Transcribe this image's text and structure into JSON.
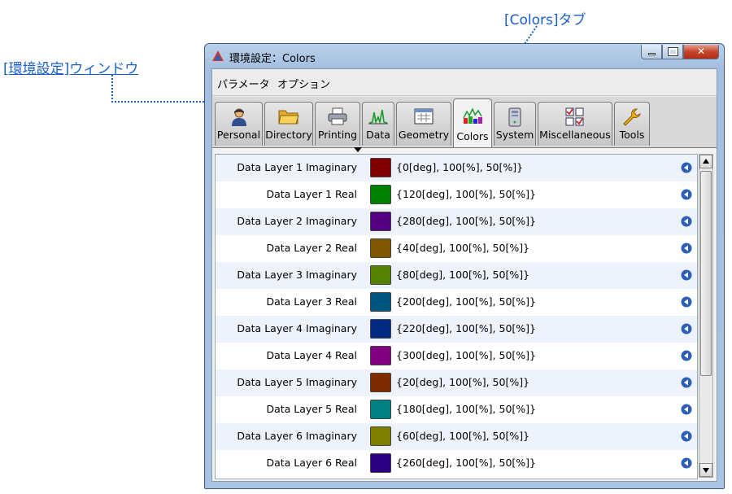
{
  "callouts": {
    "window_label": "[環境設定]ウィンドウ",
    "tab_label": "[Colors]タブ"
  },
  "window": {
    "title": "環境設定：Colors"
  },
  "menu": {
    "items": [
      "パラメータ",
      "オプション"
    ]
  },
  "tabs": [
    {
      "label": "Personal",
      "icon": "person-icon"
    },
    {
      "label": "Directory",
      "icon": "folder-icon"
    },
    {
      "label": "Printing",
      "icon": "printer-icon"
    },
    {
      "label": "Data",
      "icon": "data-plot-icon"
    },
    {
      "label": "Geometry",
      "icon": "geometry-icon"
    },
    {
      "label": "Colors",
      "icon": "colors-icon",
      "active": true
    },
    {
      "label": "System",
      "icon": "system-icon"
    },
    {
      "label": "Miscellaneous",
      "icon": "checkbox-grid-icon"
    },
    {
      "label": "Tools",
      "icon": "wrench-icon"
    }
  ],
  "rows": [
    {
      "name": "Data Layer 1 Imaginary",
      "value": "{0[deg], 100[%], 50[%]}",
      "color": "#800000"
    },
    {
      "name": "Data Layer 1 Real",
      "value": "{120[deg], 100[%], 50[%]}",
      "color": "#008000"
    },
    {
      "name": "Data Layer 2 Imaginary",
      "value": "{280[deg], 100[%], 50[%]}",
      "color": "#550080"
    },
    {
      "name": "Data Layer 2 Real",
      "value": "{40[deg], 100[%], 50[%]}",
      "color": "#805500"
    },
    {
      "name": "Data Layer 3 Imaginary",
      "value": "{80[deg], 100[%], 50[%]}",
      "color": "#558000"
    },
    {
      "name": "Data Layer 3 Real",
      "value": "{200[deg], 100[%], 50[%]}",
      "color": "#005580"
    },
    {
      "name": "Data Layer 4 Imaginary",
      "value": "{220[deg], 100[%], 50[%]}",
      "color": "#002a80"
    },
    {
      "name": "Data Layer 4 Real",
      "value": "{300[deg], 100[%], 50[%]}",
      "color": "#800080"
    },
    {
      "name": "Data Layer 5 Imaginary",
      "value": "{20[deg], 100[%], 50[%]}",
      "color": "#802a00"
    },
    {
      "name": "Data Layer 5 Real",
      "value": "{180[deg], 100[%], 50[%]}",
      "color": "#008080"
    },
    {
      "name": "Data Layer 6 Imaginary",
      "value": "{60[deg], 100[%], 50[%]}",
      "color": "#808000"
    },
    {
      "name": "Data Layer 6 Real",
      "value": "{260[deg], 100[%], 50[%]}",
      "color": "#2a0080"
    }
  ],
  "colors": {
    "callout": "#1a5fd0",
    "row_alt": "#eef2fb",
    "expand_arrow": "#2b5fb8"
  }
}
